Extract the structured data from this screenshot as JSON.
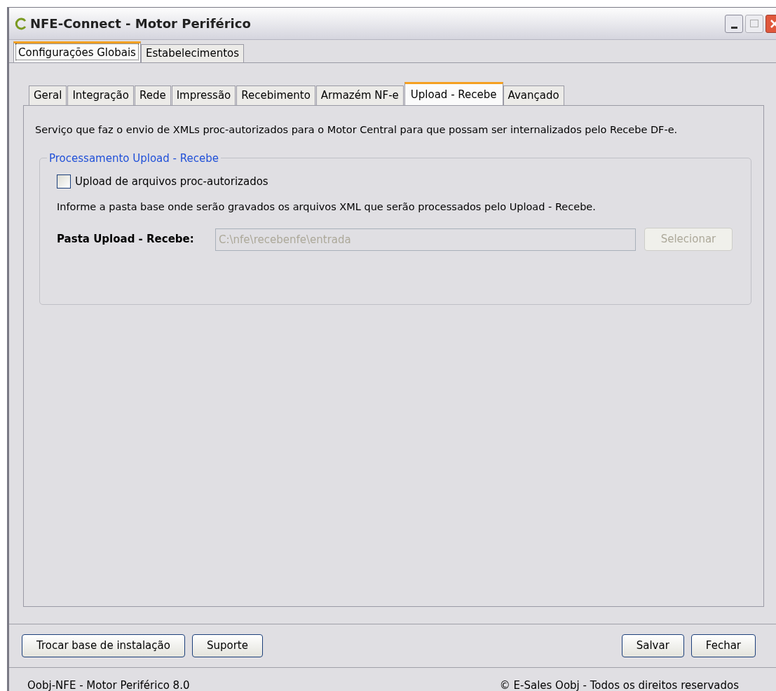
{
  "window": {
    "title": "NFE-Connect - Motor Periférico"
  },
  "outer_tabs": [
    {
      "label": "Configurações Globais",
      "selected": true
    },
    {
      "label": "Estabelecimentos",
      "selected": false
    }
  ],
  "inner_tabs": [
    {
      "label": "Geral",
      "selected": false
    },
    {
      "label": "Integração",
      "selected": false
    },
    {
      "label": "Rede",
      "selected": false
    },
    {
      "label": "Impressão",
      "selected": false
    },
    {
      "label": "Recebimento",
      "selected": false
    },
    {
      "label": "Armazém NF-e",
      "selected": false
    },
    {
      "label": "Upload - Recebe",
      "selected": true
    },
    {
      "label": "Avançado",
      "selected": false
    }
  ],
  "description": "Serviço que faz o envio de XMLs proc-autorizados para o Motor Central para que possam ser internalizados pelo Recebe DF-e.",
  "group": {
    "title": "Processamento Upload - Recebe",
    "checkbox": {
      "label": "Upload de arquivos proc-autorizados",
      "checked": false
    },
    "hint": "Informe a pasta base onde serão gravados os arquivos XML que serão processados pelo Upload - Recebe.",
    "folder": {
      "label": "Pasta Upload - Recebe:",
      "value": "C:\\nfe\\recebenfe\\entrada",
      "disabled": true
    },
    "select_button": {
      "label": "Selecionar",
      "disabled": true
    }
  },
  "left_buttons": [
    "Trocar base de instalação",
    "Suporte"
  ],
  "right_buttons": [
    "Salvar",
    "Fechar"
  ],
  "status_bar": {
    "left": "Oobj-NFE - Motor Periférico 8.0",
    "right": "© E-Sales Oobj - Todos os direitos reservados"
  }
}
